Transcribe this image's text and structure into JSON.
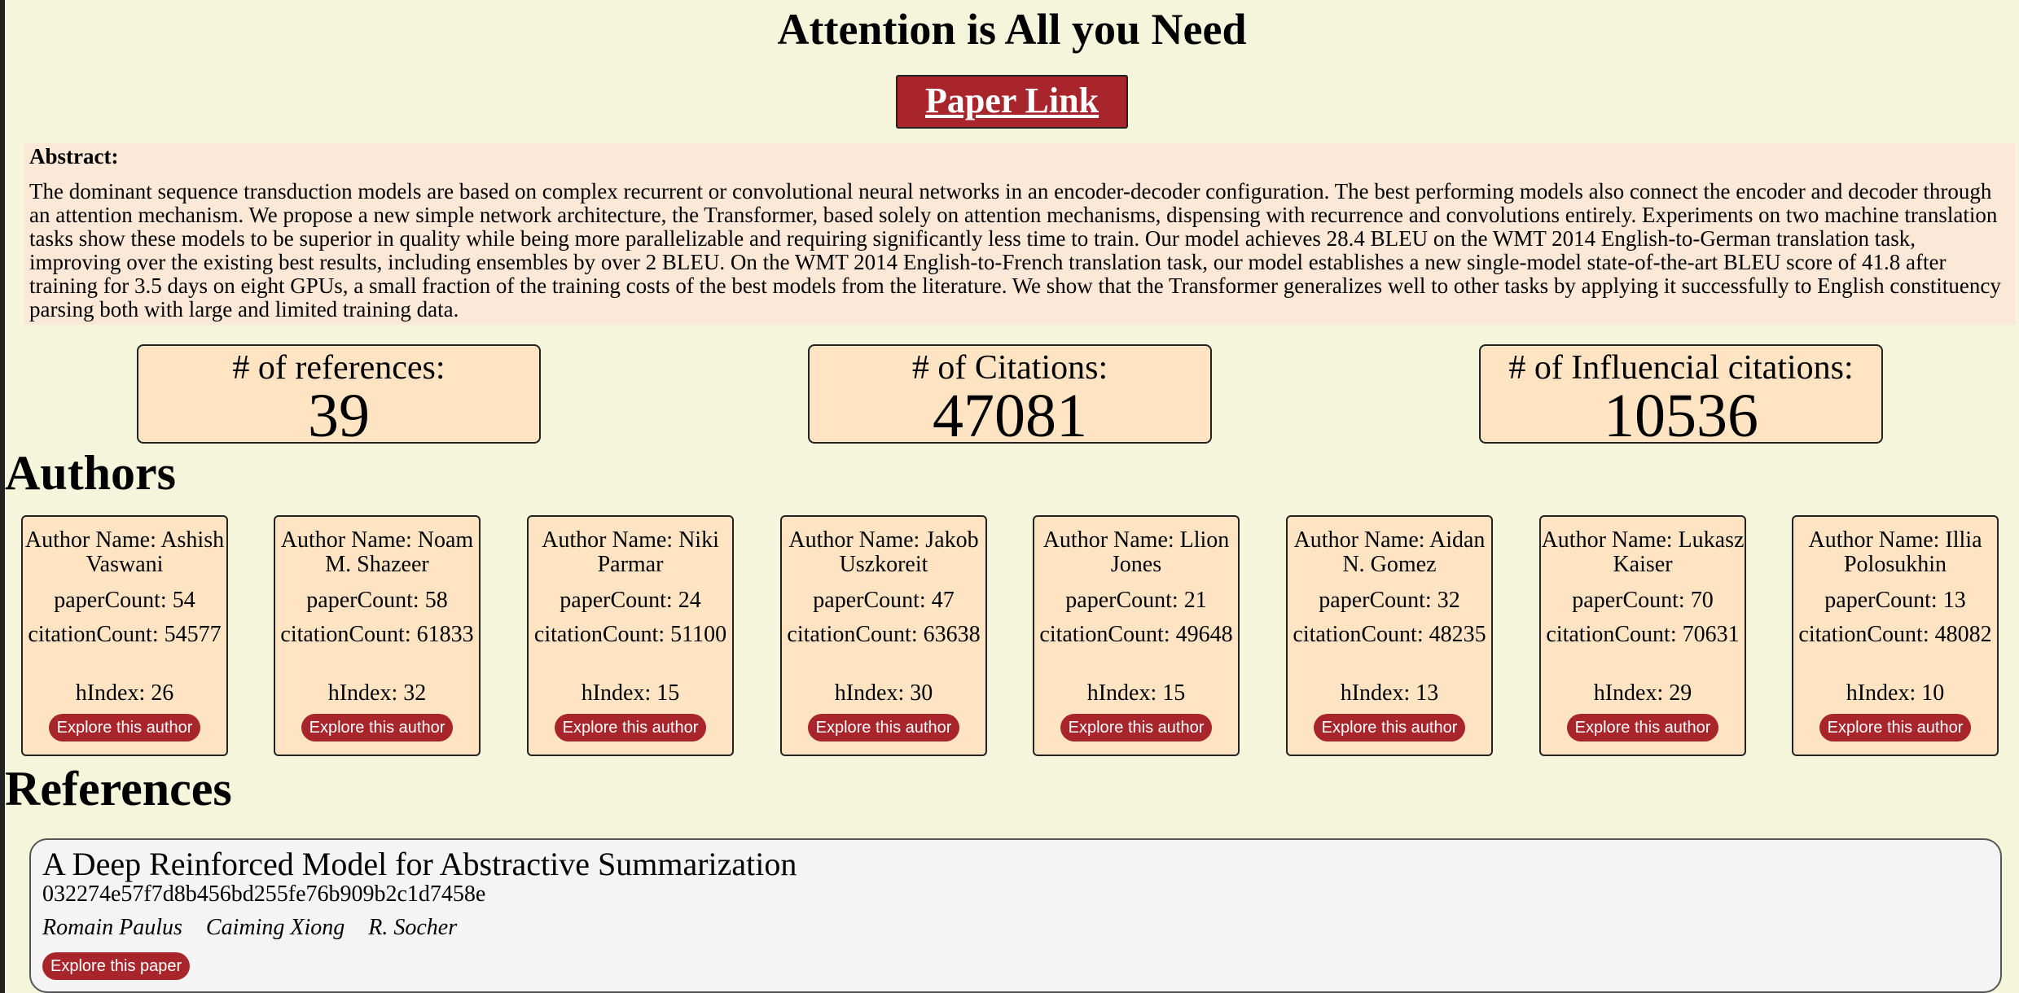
{
  "paper": {
    "title": "Attention is All you Need",
    "link_label": "Paper Link"
  },
  "abstract": {
    "label": "Abstract:",
    "text": "The dominant sequence transduction models are based on complex recurrent or convolutional neural networks in an encoder-decoder configuration. The best performing models also connect the encoder and decoder through an attention mechanism. We propose a new simple network architecture, the Transformer, based solely on attention mechanisms, dispensing with recurrence and convolutions entirely. Experiments on two machine translation tasks show these models to be superior in quality while being more parallelizable and requiring significantly less time to train. Our model achieves 28.4 BLEU on the WMT 2014 English-to-German translation task, improving over the existing best results, including ensembles by over 2 BLEU. On the WMT 2014 English-to-French translation task, our model establishes a new single-model state-of-the-art BLEU score of 41.8 after training for 3.5 days on eight GPUs, a small fraction of the training costs of the best models from the literature. We show that the Transformer generalizes well to other tasks by applying it successfully to English constituency parsing both with large and limited training data."
  },
  "stats": {
    "references": {
      "label": "# of references:",
      "value": "39"
    },
    "citations": {
      "label": "# of Citations:",
      "value": "47081"
    },
    "influential": {
      "label": "# of Influencial citations:",
      "value": "10536"
    }
  },
  "authors": {
    "heading": "Authors",
    "explore_label": "Explore this author",
    "items": [
      {
        "name": "Author Name: Ashish Vaswani",
        "paper_count": "paperCount: 54",
        "citation_count": "citationCount: 54577",
        "h_index": "hIndex: 26"
      },
      {
        "name": "Author Name: Noam M. Shazeer",
        "paper_count": "paperCount: 58",
        "citation_count": "citationCount: 61833",
        "h_index": "hIndex: 32"
      },
      {
        "name": "Author Name: Niki Parmar",
        "paper_count": "paperCount: 24",
        "citation_count": "citationCount: 51100",
        "h_index": "hIndex: 15"
      },
      {
        "name": "Author Name: Jakob Uszkoreit",
        "paper_count": "paperCount: 47",
        "citation_count": "citationCount: 63638",
        "h_index": "hIndex: 30"
      },
      {
        "name": "Author Name: Llion Jones",
        "paper_count": "paperCount: 21",
        "citation_count": "citationCount: 49648",
        "h_index": "hIndex: 15"
      },
      {
        "name": "Author Name: Aidan N. Gomez",
        "paper_count": "paperCount: 32",
        "citation_count": "citationCount: 48235",
        "h_index": "hIndex: 13"
      },
      {
        "name": "Author Name: Lukasz Kaiser",
        "paper_count": "paperCount: 70",
        "citation_count": "citationCount: 70631",
        "h_index": "hIndex: 29"
      },
      {
        "name": "Author Name: Illia Polosukhin",
        "paper_count": "paperCount: 13",
        "citation_count": "citationCount: 48082",
        "h_index": "hIndex: 10"
      }
    ]
  },
  "references": {
    "heading": "References",
    "explore_label": "Explore this paper",
    "items": [
      {
        "title": "A Deep Reinforced Model for Abstractive Summarization",
        "id": "032274e57f7d8b456bd255fe76b909b2c1d7458e",
        "authors": [
          "Romain Paulus",
          "Caiming Xiong",
          "R. Socher"
        ]
      }
    ]
  },
  "colors": {
    "background": "#f5f5dc",
    "accent": "#a8262b",
    "card": "#ffe4c4",
    "abstract_bg": "#fbe8d6"
  }
}
